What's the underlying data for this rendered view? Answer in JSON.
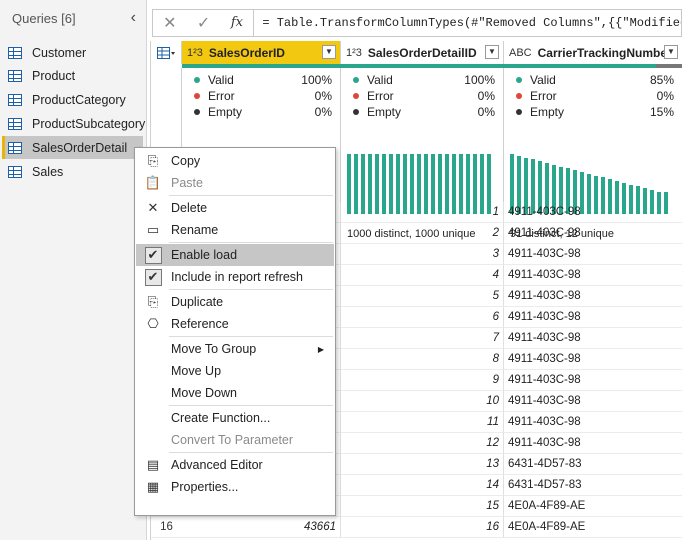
{
  "queries": {
    "title": "Queries [6]",
    "collapse_glyph": "‹",
    "items": [
      {
        "label": "Customer"
      },
      {
        "label": "Product"
      },
      {
        "label": "ProductCategory"
      },
      {
        "label": "ProductSubcategory"
      },
      {
        "label": "SalesOrderDetail",
        "selected": true
      },
      {
        "label": "Sales"
      }
    ]
  },
  "formula": {
    "cancel_glyph": "✕",
    "confirm_glyph": "✓",
    "fx_label": "fx",
    "text": "= Table.TransformColumnTypes(#\"Removed Columns\",{{\"ModifiedDat"
  },
  "grid": {
    "columns": [
      {
        "type_label": "1²3",
        "name": "SalesOrderID",
        "active": true,
        "valid": "100%",
        "error": "0%",
        "empty": "0%",
        "distinct": ""
      },
      {
        "type_label": "1²3",
        "name": "SalesOrderDetailID",
        "valid": "100%",
        "error": "0%",
        "empty": "0%",
        "distinct": "1000 distinct, 1000 unique"
      },
      {
        "type_label": "ABC",
        "name": "CarrierTrackingNumber",
        "valid": "85%",
        "error": "0%",
        "empty": "15%",
        "distinct": "91 distinct, 12 unique"
      }
    ],
    "profile_labels": {
      "valid": "Valid",
      "error": "Error",
      "empty": "Empty"
    },
    "colors": {
      "valid": "#2aa68c",
      "error": "#e0453a",
      "empty": "#333333",
      "quality": "#2aa68c",
      "quality_empty": "#777777"
    },
    "rows": [
      {
        "detail_id": "1",
        "tracking": "4911-403C-98"
      },
      {
        "detail_id": "2",
        "tracking": "4911-403C-98"
      },
      {
        "detail_id": "3",
        "tracking": "4911-403C-98"
      },
      {
        "detail_id": "4",
        "tracking": "4911-403C-98"
      },
      {
        "detail_id": "5",
        "tracking": "4911-403C-98"
      },
      {
        "detail_id": "6",
        "tracking": "4911-403C-98"
      },
      {
        "detail_id": "7",
        "tracking": "4911-403C-98"
      },
      {
        "detail_id": "8",
        "tracking": "4911-403C-98"
      },
      {
        "detail_id": "9",
        "tracking": "4911-403C-98"
      },
      {
        "detail_id": "10",
        "tracking": "4911-403C-98"
      },
      {
        "detail_id": "11",
        "tracking": "4911-403C-98"
      },
      {
        "detail_id": "12",
        "tracking": "4911-403C-98"
      },
      {
        "detail_id": "13",
        "tracking": "6431-4D57-83"
      },
      {
        "detail_id": "14",
        "tracking": "6431-4D57-83"
      },
      {
        "detail_id": "15",
        "tracking": "4E0A-4F89-AE"
      },
      {
        "detail_id": "16",
        "tracking": "4E0A-4F89-AE",
        "row_num": "16",
        "order_id": "43661"
      }
    ]
  },
  "context_menu": {
    "items": [
      {
        "label": "Copy",
        "icon": "copy-icon",
        "glyph": "⎘"
      },
      {
        "label": "Paste",
        "icon": "paste-icon",
        "glyph": "📋",
        "disabled": true
      },
      {
        "sep": true
      },
      {
        "label": "Delete",
        "icon": "delete-icon",
        "glyph": "✕"
      },
      {
        "label": "Rename",
        "icon": "rename-icon",
        "glyph": "▭"
      },
      {
        "sep": true
      },
      {
        "label": "Enable load",
        "icon": "checkbox-checked-icon",
        "checked": true,
        "highlighted": true
      },
      {
        "label": "Include in report refresh",
        "icon": "checkbox-checked-icon",
        "checked": true
      },
      {
        "sep": true
      },
      {
        "label": "Duplicate",
        "icon": "duplicate-icon",
        "glyph": "⎘"
      },
      {
        "label": "Reference",
        "icon": "reference-icon",
        "glyph": "⎔"
      },
      {
        "sep": true
      },
      {
        "label": "Move To Group",
        "submenu": true
      },
      {
        "label": "Move Up"
      },
      {
        "label": "Move Down"
      },
      {
        "sep": true
      },
      {
        "label": "Create Function..."
      },
      {
        "label": "Convert To Parameter",
        "disabled": true
      },
      {
        "sep": true
      },
      {
        "label": "Advanced Editor",
        "icon": "advanced-editor-icon",
        "glyph": "▤"
      },
      {
        "label": "Properties...",
        "icon": "properties-icon",
        "glyph": "▦"
      }
    ]
  }
}
